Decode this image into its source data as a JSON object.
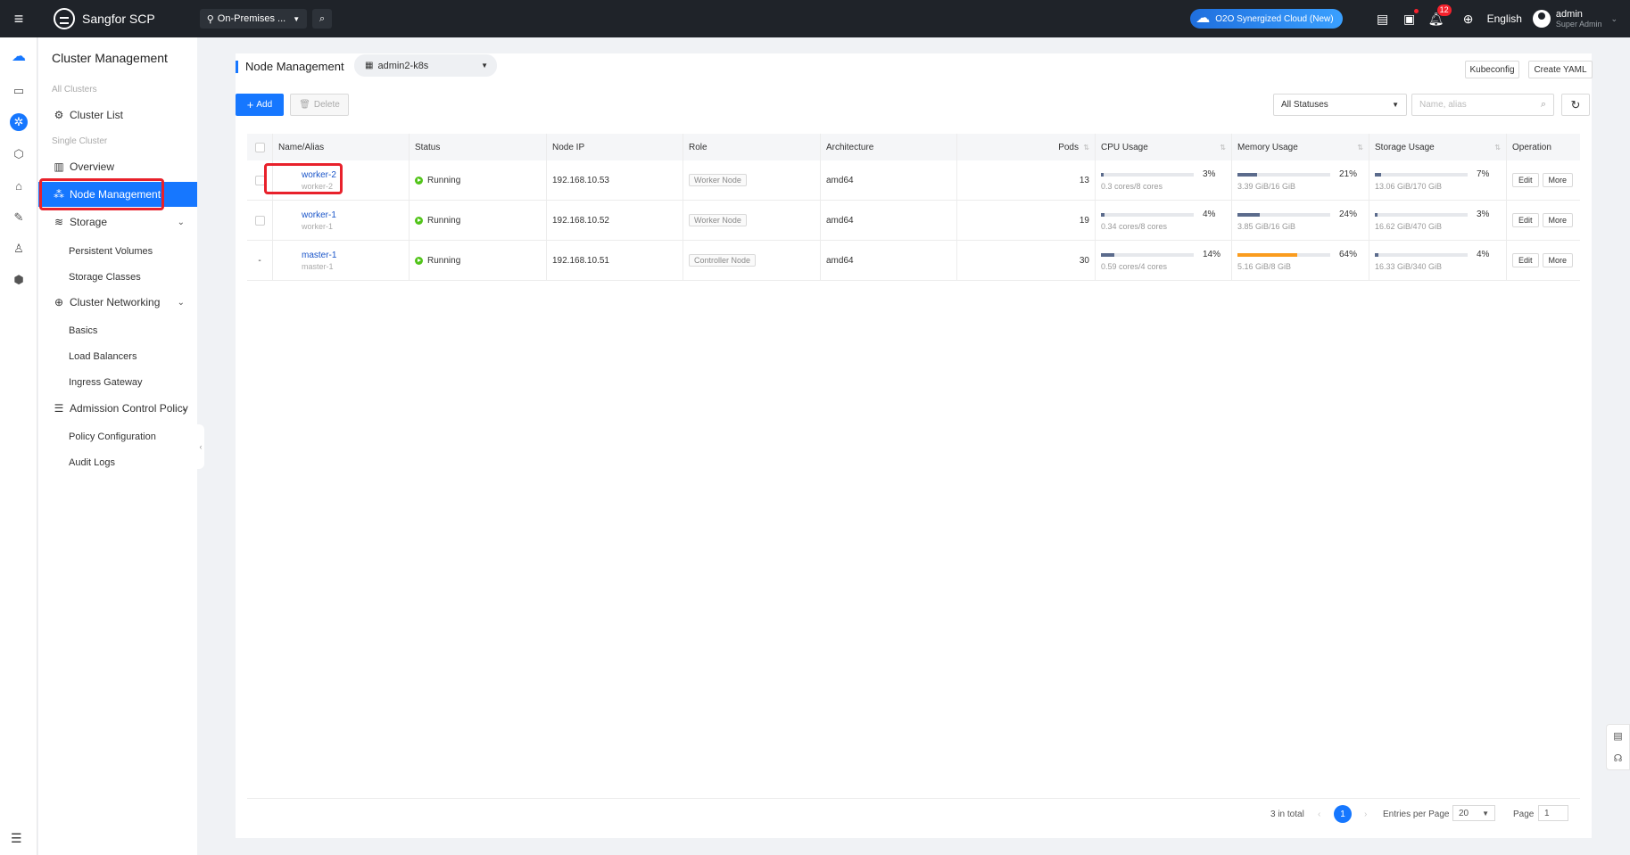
{
  "topbar": {
    "brand": "Sangfor SCP",
    "region": "On-Premises ...",
    "o2o": "O2O Synergized Cloud (New)",
    "notif_count": "12",
    "language": "English",
    "user_name": "admin",
    "user_role": "Super Admin"
  },
  "sidebar": {
    "title": "Cluster Management",
    "group_all": "All Clusters",
    "cluster_list": "Cluster List",
    "group_single": "Single Cluster",
    "overview": "Overview",
    "node_management": "Node Management",
    "storage": "Storage",
    "persistent_volumes": "Persistent Volumes",
    "storage_classes": "Storage Classes",
    "cluster_networking": "Cluster Networking",
    "basics": "Basics",
    "load_balancers": "Load Balancers",
    "ingress_gateway": "Ingress Gateway",
    "admission_control": "Admission Control Policy",
    "policy_configuration": "Policy Configuration",
    "audit_logs": "Audit Logs"
  },
  "page": {
    "title": "Node Management",
    "cluster": "admin2-k8s",
    "kubeconfig": "Kubeconfig",
    "create_yaml": "Create YAML",
    "add": "Add",
    "delete": "Delete",
    "status_filter": "All Statuses",
    "search_placeholder": "Name, alias"
  },
  "table": {
    "columns": {
      "name": "Name/Alias",
      "status": "Status",
      "ip": "Node IP",
      "role": "Role",
      "arch": "Architecture",
      "pods": "Pods",
      "cpu": "CPU Usage",
      "memory": "Memory Usage",
      "storage": "Storage Usage",
      "operation": "Operation"
    },
    "rows": [
      {
        "name": "worker-2",
        "alias": "worker-2",
        "status": "Running",
        "ip": "192.168.10.53",
        "role": "Worker Node",
        "arch": "amd64",
        "pods": "13",
        "cpu_pct": "3%",
        "cpu_sub": "0.3 cores/8 cores",
        "cpu_frac": 0.03,
        "mem_pct": "21%",
        "mem_sub": "3.39 GiB/16 GiB",
        "mem_frac": 0.21,
        "sto_pct": "7%",
        "sto_sub": "13.06 GiB/170 GiB",
        "sto_frac": 0.07,
        "edit": "Edit",
        "more": "More",
        "select_marker": ""
      },
      {
        "name": "worker-1",
        "alias": "worker-1",
        "status": "Running",
        "ip": "192.168.10.52",
        "role": "Worker Node",
        "arch": "amd64",
        "pods": "19",
        "cpu_pct": "4%",
        "cpu_sub": "0.34 cores/8 cores",
        "cpu_frac": 0.04,
        "mem_pct": "24%",
        "mem_sub": "3.85 GiB/16 GiB",
        "mem_frac": 0.24,
        "sto_pct": "3%",
        "sto_sub": "16.62 GiB/470 GiB",
        "sto_frac": 0.03,
        "edit": "Edit",
        "more": "More",
        "select_marker": ""
      },
      {
        "name": "master-1",
        "alias": "master-1",
        "status": "Running",
        "ip": "192.168.10.51",
        "role": "Controller Node",
        "arch": "amd64",
        "pods": "30",
        "cpu_pct": "14%",
        "cpu_sub": "0.59 cores/4 cores",
        "cpu_frac": 0.14,
        "mem_pct": "64%",
        "mem_sub": "5.16 GiB/8 GiB",
        "mem_frac": 0.64,
        "sto_pct": "4%",
        "sto_sub": "16.33 GiB/340 GiB",
        "sto_frac": 0.04,
        "edit": "Edit",
        "more": "More",
        "select_marker": "-"
      }
    ]
  },
  "pager": {
    "total": "3 in total",
    "current": "1",
    "entries_label": "Entries per Page",
    "entries": "20",
    "page_label": "Page",
    "page_value": "1"
  },
  "colors": {
    "accent": "#1677ff",
    "topbar": "#1f2329",
    "usage_normal": "#5b6b8c",
    "usage_warn": "#fa9c1e",
    "running": "#52c41a",
    "highlight": "#e8212b"
  }
}
